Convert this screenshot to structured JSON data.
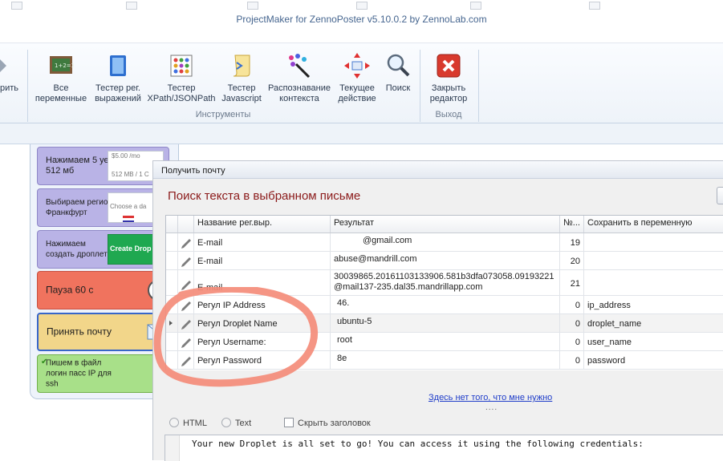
{
  "window": {
    "title": "ProjectMaker for ZennoPoster v5.10.0.2 by ZennoLab.com"
  },
  "ribbon": {
    "cut_label": "рить",
    "buttons": [
      {
        "line1": "Все",
        "line2": "переменные"
      },
      {
        "line1": "Тестер рег.",
        "line2": "выражений"
      },
      {
        "line1": "Тестер",
        "line2": "XPath/JSONPath"
      },
      {
        "line1": "Тестер",
        "line2": "Javascript"
      },
      {
        "line1": "Распознавание",
        "line2": "контекста"
      },
      {
        "line1": "Текущее",
        "line2": "действие"
      },
      {
        "line1": "Поиск",
        "line2": ""
      },
      {
        "line1": "Закрыть",
        "line2": "редактор"
      }
    ],
    "group_tools": "Инструменты",
    "group_exit": "Выход"
  },
  "flow": {
    "nodes": [
      {
        "label": "Нажимаем 5 уе 512 мб",
        "thumb_top": "$5.00 /mo",
        "thumb_bottom": "512 MB / 1 C"
      },
      {
        "label": "Выбираем регион Франкфурт",
        "thumb_top": "Choose a da"
      },
      {
        "label": "Нажимаем создать дроплет",
        "thumb_top": "Create Drop"
      },
      {
        "label": "Пауза 60 с"
      },
      {
        "label": "Принять почту"
      },
      {
        "label": "Пишем в файл логин пасс IP для ssh"
      }
    ],
    "colors": {
      "purple": "#b9b3e6",
      "red": "#f0735e",
      "yellow": "#f2d68a",
      "green": "#a8e089"
    }
  },
  "dialog": {
    "title": "Получить почту",
    "heading": "Поиск текста в выбранном письме",
    "columns": [
      "Название рег.выр.",
      "Результат",
      "№...",
      "Сохранить в переменную"
    ],
    "rows": [
      {
        "name": "E-mail",
        "result": "@gmail.com",
        "num": "19",
        "var": ""
      },
      {
        "name": "E-mail",
        "result": "abuse@mandrill.com",
        "num": "20",
        "var": ""
      },
      {
        "name": "E-mail",
        "result": "30039865.20161103133906.581b3dfa073058.09193221",
        "result2": "@mail137-235.dal35.mandrillapp.com",
        "num": "21",
        "var": ""
      },
      {
        "name": "Регул IP Address",
        "result": "46.",
        "num": "0",
        "var": "ip_address"
      },
      {
        "name": "Регул Droplet Name",
        "result": "ubuntu-5",
        "num": "0",
        "var": "droplet_name"
      },
      {
        "name": "Регул Username:",
        "result": "root",
        "num": "0",
        "var": "user_name"
      },
      {
        "name": "Регул Password",
        "result": "8e",
        "num": "0",
        "var": "password"
      }
    ],
    "link": "Здесь нет того, что мне нужно",
    "dots": "....",
    "options": {
      "html": "HTML",
      "text": "Text",
      "headers": "Скрыть заголовок"
    },
    "body_text": "Your new Droplet is all set to go! You can access it using the following credentials:"
  }
}
